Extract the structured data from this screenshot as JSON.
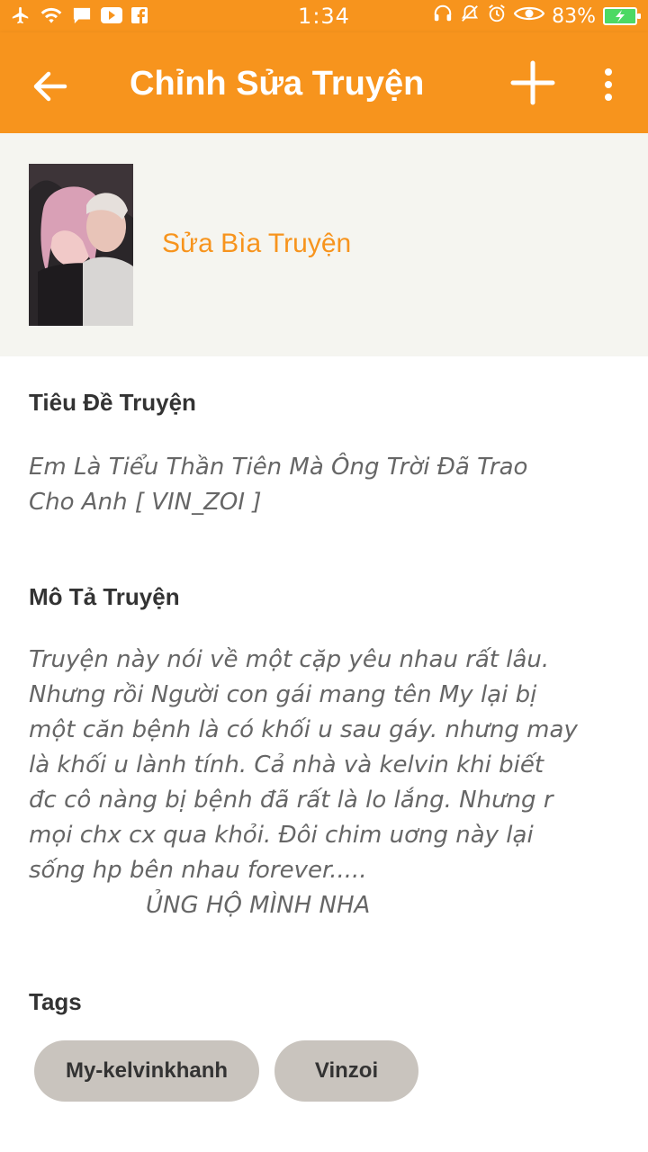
{
  "status_bar": {
    "time": "1:34",
    "battery": "83%",
    "icons_left": [
      "airplane-icon",
      "wifi-icon",
      "chat-icon",
      "youtube-icon",
      "facebook-icon"
    ],
    "icons_right": [
      "headset-icon",
      "mute-icon",
      "alarm-icon",
      "eye-icon",
      "battery-icon"
    ]
  },
  "app_bar": {
    "title": "Chỉnh Sửa Truyện",
    "accent_color": "#f7941d"
  },
  "cover": {
    "edit_label": "Sửa Bìa Truyện"
  },
  "story": {
    "title_label": "Tiêu Đề Truyện",
    "title_lines": [
      "Em Là Tiểu Thần Tiên Mà Ông Trời Đã Trao",
      "Cho Anh [ VIN_ZOI ]"
    ],
    "description_label": "Mô Tả Truyện",
    "description_lines": [
      "Truyện này nói về một cặp yêu nhau rất lâu.",
      "Nhưng rồi Người con gái mang tên My lại bị",
      "một căn bệnh là có khối u sau gáy. nhưng may",
      "là khối u lành tính. Cả nhà và kelvin khi biết",
      "đc cô nàng bị bệnh đã rất là lo lắng. Nhưng r",
      "mọi chx cx qua khỏi. Đôi chim uơng này lại",
      "sống hp bên nhau forever.....",
      "ỦNG HỘ MÌNH NHA"
    ],
    "tags_label": "Tags",
    "tags": [
      "My-kelvinkhanh",
      "Vinzoi"
    ]
  }
}
